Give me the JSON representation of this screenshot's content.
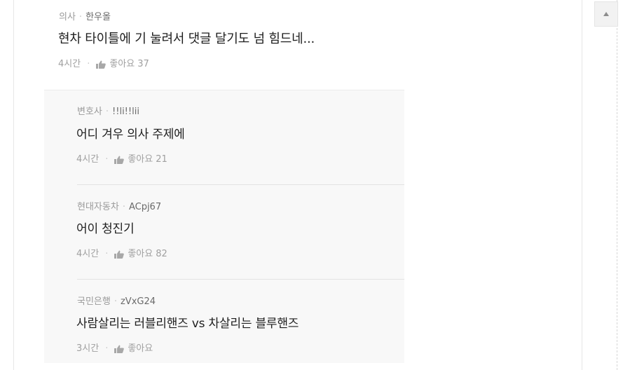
{
  "comments": [
    {
      "job": "의사",
      "separator": "·",
      "nickname": "한우올",
      "text": "현차 타이틀에 기 눌려서 댓글 달기도 넘 힘드네...",
      "time": "4시간",
      "like_label": "좋아요",
      "like_count": "37"
    },
    {
      "job": "변호사",
      "separator": "·",
      "nickname": "!!li!!lii",
      "text": "어디 겨우 의사 주제에",
      "time": "4시간",
      "like_label": "좋아요",
      "like_count": "21"
    },
    {
      "job": "현대자동차",
      "separator": "·",
      "nickname": "ACpj67",
      "text": "어이 청진기",
      "time": "4시간",
      "like_label": "좋아요",
      "like_count": "82"
    },
    {
      "job": "국민은행",
      "separator": "·",
      "nickname": "zVxG24",
      "text": "사람살리는 러블리핸즈 vs 차살리는 블루핸즈",
      "time": "3시간",
      "like_label": "좋아요",
      "like_count": ""
    }
  ],
  "footer_dot": "·",
  "icons": {
    "like": "thumbs-up-icon",
    "scroll_top": "caret-up-icon"
  },
  "colors": {
    "reply_background": "#f8f8f8",
    "text_primary": "#1e1e1e",
    "text_meta": "#8a8a8a"
  }
}
